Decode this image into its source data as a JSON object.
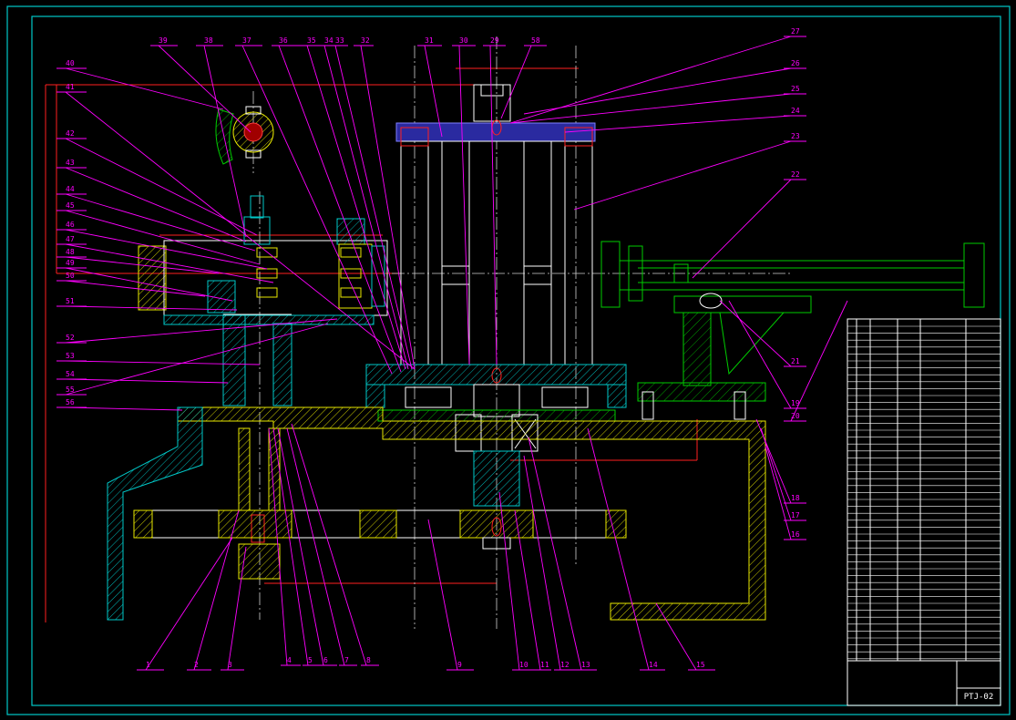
{
  "drawing_no": "PTJ-02",
  "balloons_top": [
    "39",
    "38",
    "37",
    "36",
    "35",
    "34",
    "33",
    "32",
    "31",
    "30",
    "29",
    "58"
  ],
  "balloons_left": [
    "40",
    "41",
    "42",
    "43",
    "44",
    "45",
    "46",
    "47",
    "48",
    "49",
    "50",
    "51",
    "52",
    "53",
    "54",
    "55",
    "56"
  ],
  "balloons_right": [
    "27",
    "26",
    "25",
    "24",
    "23",
    "22",
    "21",
    "19",
    "20",
    "18",
    "17",
    "16"
  ],
  "balloons_bottom": [
    "1",
    "2",
    "3",
    "4",
    "5",
    "6",
    "7",
    "8",
    "9",
    "10",
    "11",
    "12",
    "13",
    "14",
    "15"
  ],
  "colors": {
    "background": "#000000",
    "frame": "#00c8c8",
    "outline": "#ffffff",
    "leader": "#ff00ff",
    "dimension": "#ff2020",
    "part_fill": "#2a2aa0",
    "section_hatch": "#00cccc",
    "green_part": "#00cc00",
    "yellow_parts": "#e8e800"
  }
}
